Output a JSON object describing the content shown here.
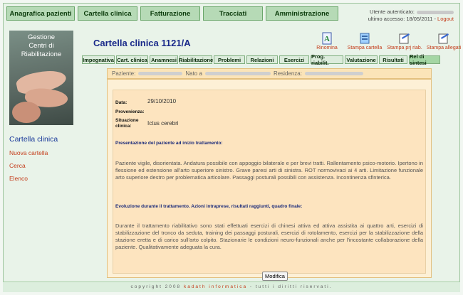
{
  "topnav": [
    {
      "label": "Anagrafica pazienti"
    },
    {
      "label": "Cartella clinica"
    },
    {
      "label": "Fatturazione"
    },
    {
      "label": "Tracciati"
    },
    {
      "label": "Amministrazione"
    }
  ],
  "user": {
    "auth_label": "Utente autenticato:",
    "last_access": "ultimo accesso: 18/05/2011 -",
    "logout": "Logout"
  },
  "sidebar": {
    "brand_line1": "Gestione",
    "brand_line2": "Centri di",
    "brand_line3": "Riabilitazione",
    "title": "Cartella clinica",
    "items": [
      {
        "label": "Nuova cartella"
      },
      {
        "label": "Cerca"
      },
      {
        "label": "Elenco"
      }
    ]
  },
  "page": {
    "title": "Cartella clinica 1121/A"
  },
  "tools": [
    {
      "label": "Rinomina",
      "icon": "rename-icon"
    },
    {
      "label": "Stampa cartella",
      "icon": "print-folder-icon"
    },
    {
      "label": "Stampa prj riab.",
      "icon": "print-project-icon"
    },
    {
      "label": "Stampa allegati",
      "icon": "print-attachments-icon"
    }
  ],
  "tabs": [
    {
      "label": "Impegnativa"
    },
    {
      "label": "Cart. clinica"
    },
    {
      "label": "Anamnesi"
    },
    {
      "label": "Riabilitazione"
    },
    {
      "label": "Problemi"
    },
    {
      "label": "Relazioni"
    },
    {
      "label": "Esercizi"
    },
    {
      "label": "Prog. riabilit."
    },
    {
      "label": "Valutazione"
    },
    {
      "label": "Risultati"
    },
    {
      "label": "Rel di sintesi"
    }
  ],
  "patient_bar": {
    "patient_label": "Paziente:",
    "born_label": "Nato a",
    "residence_label": "Residenza:"
  },
  "report": {
    "date_label": "Data:",
    "date_value": "29/10/2010",
    "provenance_label": "Provenienza:",
    "situation_label1": "Situazione",
    "situation_label2": "clinica:",
    "situation_value": "Ictus cerebri",
    "section1_title": "Presentazione del paziente ad inizio trattamento:",
    "section1_text": "Paziente vigile, disorientata. Andatura possibile con appoggio bilaterale e per brevi tratti. Rallentamento psico-motorio. Ipertono in flessione ed estensione all'arto superiore sinistro. Grave paresi arti di sinistra. ROT normovivaci ai 4 arti. Limitazione funzionale arto superiore destro per problematica articolare. Passaggi posturali possibili con assistenza. Incontinenza sfinterica.",
    "section2_title": "Evoluzione durante il trattamento. Azioni intraprese, risultati raggiunti, quadro finale:",
    "section2_text": "Durante il trattamento riabilitativo sono stati effettuati esercizi di chinesi attiva ed attiva assistita ai quattro arti, esercizi di stabilizzazione del tronco da seduta, training dei passaggi posturali, esercizi di rotolamento, esercizi per la stabilizzazione della stazione eretta e di carico sull'arto colpito. Stazionarie le condizioni neuro-funzionali anche per l'incostante collaborazione della paziente. Qualitativamente adeguata la cura.",
    "modify_button": "Modifica"
  },
  "footer": {
    "prefix": "copyright 2008",
    "brand": "kadath informatica",
    "suffix": "- tutti i diritti riservati."
  },
  "colors": {
    "nav_green": "#b6dab6",
    "title_blue": "#1a2a8a",
    "link_red": "#c43c1a",
    "card_bg": "#fde4bf"
  }
}
